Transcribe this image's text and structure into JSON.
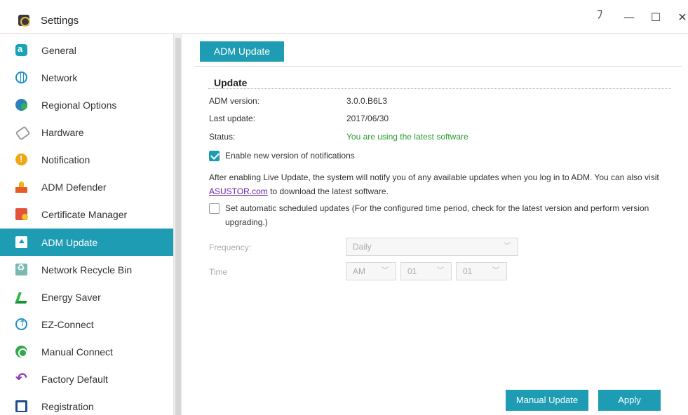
{
  "window": {
    "title": "Settings",
    "controls": {
      "help": "ﾌ",
      "minimize": "—",
      "maximize": "☐",
      "close": "✕"
    }
  },
  "sidebar": {
    "items": [
      {
        "label": "General",
        "icon": "general-icon"
      },
      {
        "label": "Network",
        "icon": "network-icon"
      },
      {
        "label": "Regional Options",
        "icon": "regional-options-icon"
      },
      {
        "label": "Hardware",
        "icon": "hardware-icon"
      },
      {
        "label": "Notification",
        "icon": "notification-icon"
      },
      {
        "label": "ADM Defender",
        "icon": "adm-defender-icon"
      },
      {
        "label": "Certificate Manager",
        "icon": "certificate-manager-icon"
      },
      {
        "label": "ADM Update",
        "icon": "adm-update-icon",
        "active": true
      },
      {
        "label": "Network Recycle Bin",
        "icon": "network-recycle-bin-icon"
      },
      {
        "label": "Energy Saver",
        "icon": "energy-saver-icon"
      },
      {
        "label": "EZ-Connect",
        "icon": "ez-connect-icon"
      },
      {
        "label": "Manual Connect",
        "icon": "manual-connect-icon"
      },
      {
        "label": "Factory Default",
        "icon": "factory-default-icon"
      },
      {
        "label": "Registration",
        "icon": "registration-icon"
      }
    ]
  },
  "main": {
    "tab": "ADM Update",
    "section_title": "Update",
    "adm_version_label": "ADM version:",
    "adm_version_value": "3.0.0.B6L3",
    "last_update_label": "Last update:",
    "last_update_value": "2017/06/30",
    "status_label": "Status:",
    "status_value": "You are using the latest software",
    "enable_notifications_label": "Enable new version of notifications",
    "enable_notifications_checked": true,
    "info_text_before_link": "After enabling Live Update, the system will notify you of any available updates when you log in to ADM. You can also visit ",
    "info_link": "ASUSTOR.com",
    "info_text_after_link": " to download the latest software.",
    "scheduled_label": "Set automatic scheduled updates (For the configured time period, check for the latest version and perform version upgrading.)",
    "scheduled_checked": false,
    "frequency_label": "Frequency:",
    "frequency_value": "Daily",
    "time_label": "Time",
    "time_ampm": "AM",
    "time_hour": "01",
    "time_minute": "01",
    "chevron": "﹀",
    "manual_update_button": "Manual Update",
    "apply_button": "Apply"
  },
  "colors": {
    "accent": "#1e9cb4",
    "status_green": "#2a9a32",
    "link": "#6a1fa8"
  }
}
